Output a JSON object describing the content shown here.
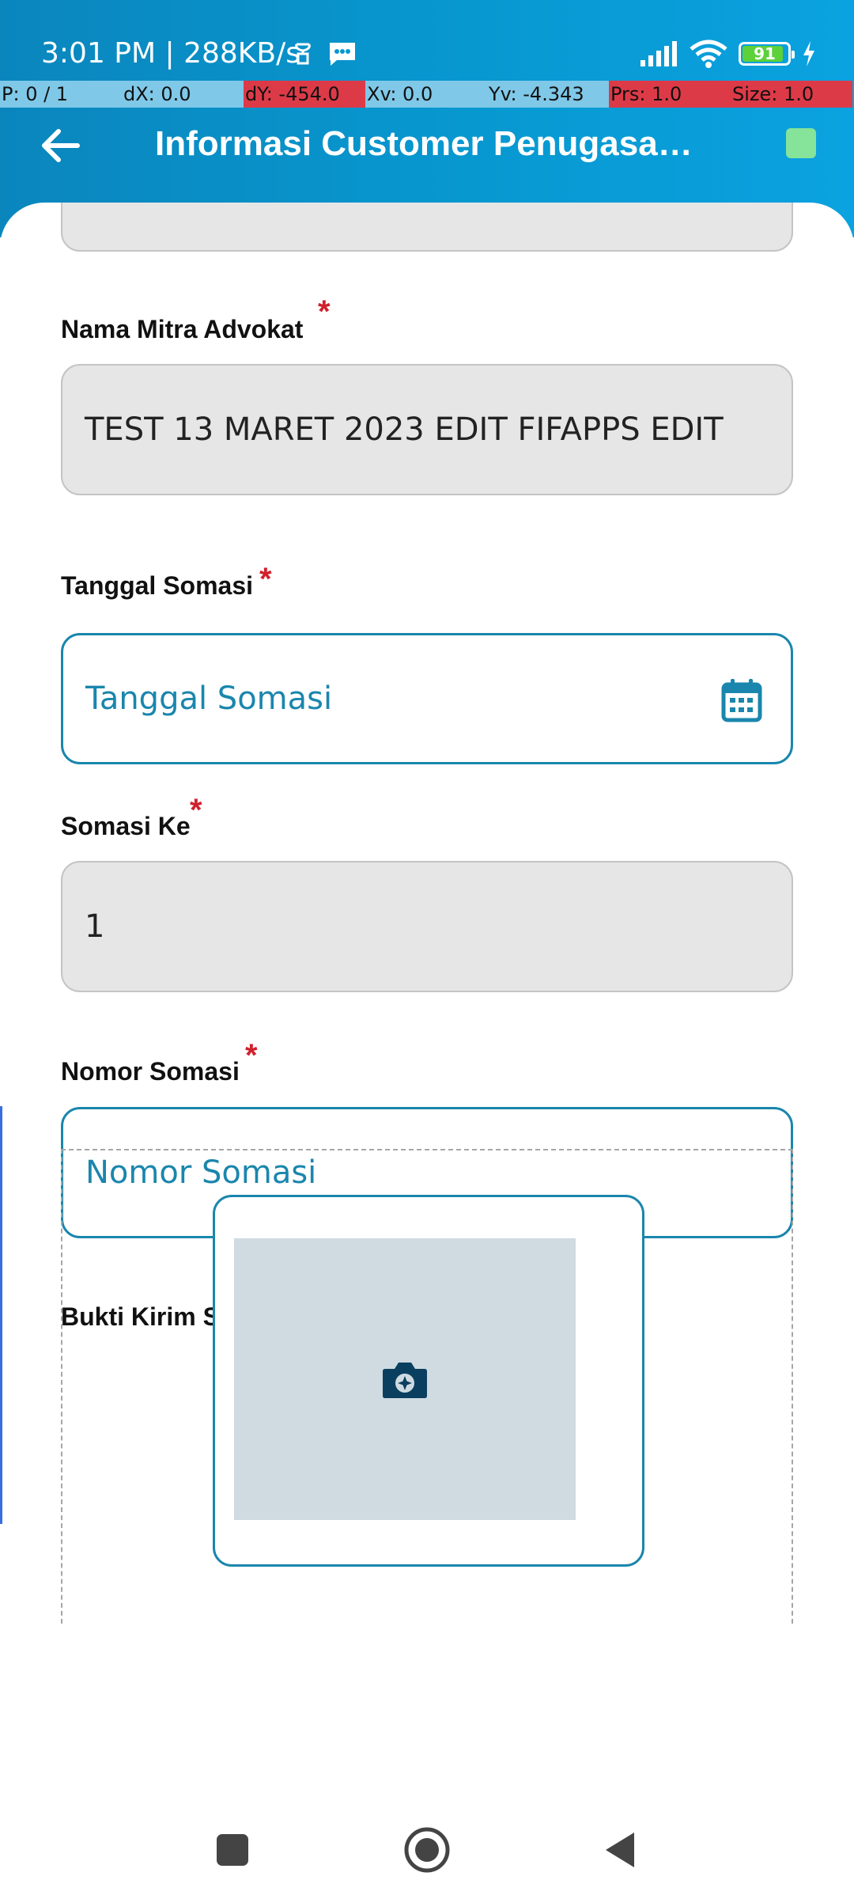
{
  "status_bar": {
    "time": "3:01 PM | 288KB/s",
    "battery_level": 91,
    "battery_text": "91"
  },
  "debug_overlay": {
    "cells": [
      "P: 0 / 1",
      "dX: 0.0",
      "dY: -454.0",
      "Xv: 0.0",
      "Yv: -4.343",
      "Prs: 1.0",
      "Size: 1.0"
    ]
  },
  "app_bar": {
    "title": "Informasi Customer Penugasan ...",
    "indicator_color": "#86e39a"
  },
  "form": {
    "nama_mitra": {
      "label": "Nama Mitra Advokat",
      "value": "TEST 13 MARET 2023 EDIT FIFAPPS EDIT",
      "required": "*"
    },
    "tanggal_somasi": {
      "label": "Tanggal Somasi",
      "placeholder": "Tanggal Somasi",
      "required": "*"
    },
    "somasi_ke": {
      "label": "Somasi Ke",
      "value": "1",
      "required": "*"
    },
    "nomor_somasi": {
      "label": "Nomor Somasi",
      "placeholder": "Nomor Somasi",
      "required": "*"
    },
    "bukti_kirim": {
      "label": "Bukti Kirim Somasi",
      "required": "*"
    }
  },
  "colors": {
    "accent": "#1a86ad",
    "required": "#d0202c",
    "readonly_bg": "#e6e6e6",
    "header": "#0898d0"
  },
  "icons": {
    "back": "arrow-left-icon",
    "calendar": "calendar-icon",
    "camera": "camera-icon",
    "nav_recents": "square-icon",
    "nav_home": "circle-icon",
    "nav_back": "triangle-back-icon"
  }
}
